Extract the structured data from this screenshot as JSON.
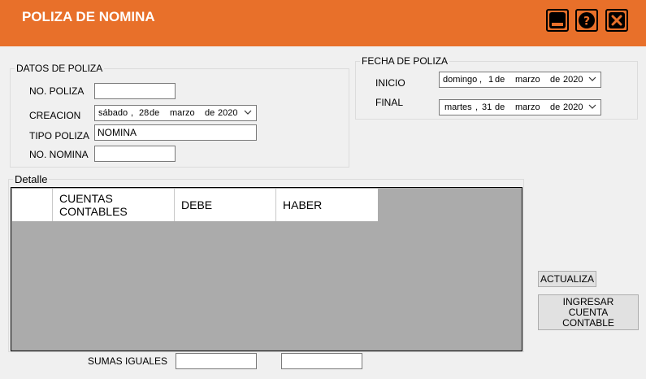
{
  "window": {
    "title": "POLIZA DE NOMINA"
  },
  "datos": {
    "legend": "DATOS DE POLIZA",
    "no_poliza_label": "NO. POLIZA",
    "no_poliza_value": "",
    "creacion_label": "CREACION",
    "creacion_date": {
      "day_name": "sábado",
      "day": "28",
      "de1": "de",
      "month": "marzo",
      "de2": "de",
      "year": "2020"
    },
    "tipo_label": "TIPO POLIZA",
    "tipo_value": "NOMINA",
    "no_nomina_label": "NO. NOMINA",
    "no_nomina_value": ""
  },
  "fecha": {
    "legend": "FECHA DE POLIZA",
    "inicio_label": "INICIO",
    "inicio_date": {
      "day_name": "domingo",
      "day": "1",
      "de1": "de",
      "month": "marzo",
      "de2": "de",
      "year": "2020"
    },
    "final_label": "FINAL",
    "final_date": {
      "day_name": "martes",
      "day": "31",
      "de1": "de",
      "month": "marzo",
      "de2": "de",
      "year": "2020"
    }
  },
  "detalle": {
    "legend": "Detalle",
    "columns": [
      "",
      "CUENTAS CONTABLES",
      "DEBE",
      "HABER"
    ]
  },
  "buttons": {
    "actualiza": "ACTUALIZA",
    "ingresar": "INGRESAR CUENTA CONTABLE"
  },
  "sumas": {
    "label": "SUMAS IGUALES",
    "debe_value": "",
    "haber_value": ""
  },
  "icons": [
    "minimize-icon",
    "help-icon",
    "close-icon",
    "chevron-down-icon"
  ],
  "colors": {
    "titlebar": "#e8702a",
    "grid_background": "#ababab"
  }
}
